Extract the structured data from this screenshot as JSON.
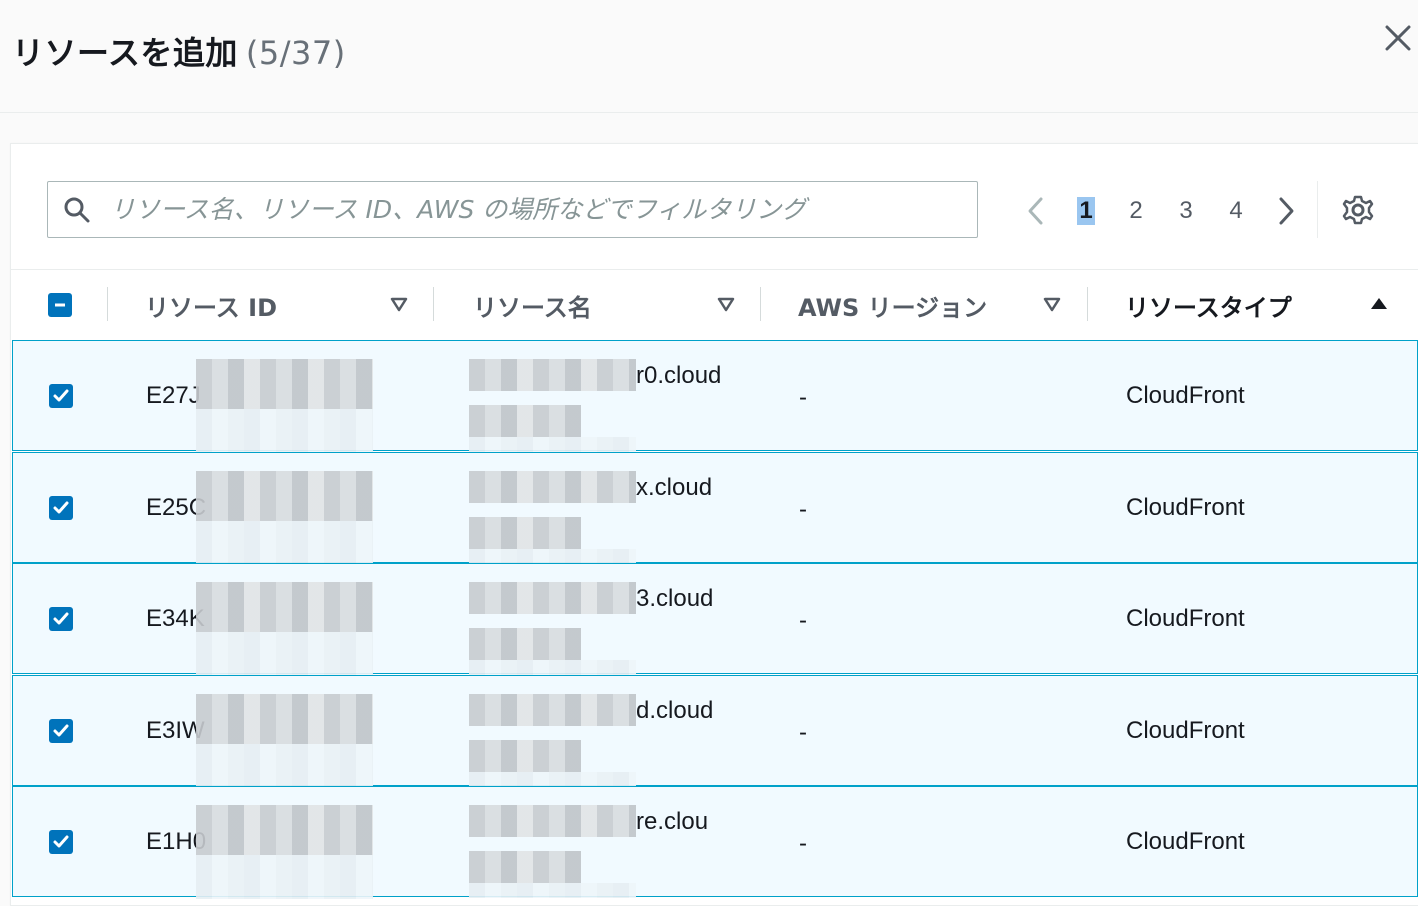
{
  "header": {
    "title": "リソースを追加",
    "count": "(5/37)"
  },
  "filter": {
    "placeholder": "リソース名、リソース ID、AWS の場所などでフィルタリング"
  },
  "pagination": {
    "pages": [
      "1",
      "2",
      "3",
      "4"
    ],
    "current": "1"
  },
  "table": {
    "columns": [
      "リソース ID",
      "リソース名",
      "AWS リージョン",
      "リソースタイプ"
    ],
    "rows": [
      {
        "id": "E27J",
        "name": "r0.cloud",
        "region": "-",
        "type": "CloudFront",
        "selected": true
      },
      {
        "id": "E25C",
        "name": "x.cloud",
        "region": "-",
        "type": "CloudFront",
        "selected": true
      },
      {
        "id": "E34K",
        "name": "3.cloud",
        "region": "-",
        "type": "CloudFront",
        "selected": true
      },
      {
        "id": "E3IW",
        "name": "d.cloud",
        "region": "-",
        "type": "CloudFront",
        "selected": true
      },
      {
        "id": "E1H0",
        "name": "re.clou",
        "region": "-",
        "type": "CloudFront",
        "selected": true
      }
    ]
  },
  "colors": {
    "accent": "#0073bb",
    "selected_row_bg": "#f1faff",
    "selected_row_border": "#00a1c9"
  }
}
